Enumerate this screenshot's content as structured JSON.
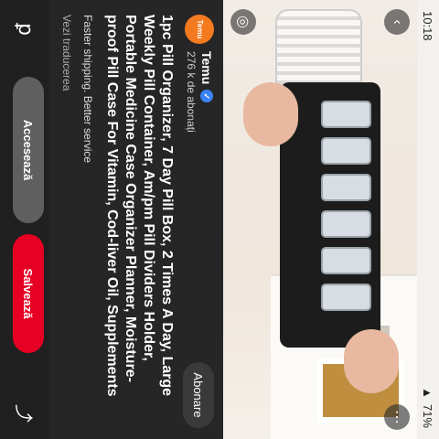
{
  "status_bar": {
    "time": "10:18",
    "battery": "71%"
  },
  "channel": {
    "avatar_text": "Temu",
    "name": "Temu",
    "subscribers": "276 k de abonați",
    "follow_label": "Abonare"
  },
  "pin": {
    "title": "1pc Pill Organizer, 7 Day Pill Box, 2 Times A Day, Large Weekly Pill Container, Am/pm Pill Dividers Holder, Portable Medicine Case Organizer Planner, Moisture-proof Pill Case For Vitamin, Cod-liver Oil, Supplements",
    "subtitle": "Faster shipping. Better service",
    "translate_label": "Vezi traducerea"
  },
  "actions": {
    "visit_label": "Accesează",
    "save_label": "Salvează"
  },
  "colors": {
    "save_button": "#e60023",
    "avatar": "#f47a20",
    "verified": "#3b82f6"
  },
  "icons": [
    "back-icon",
    "more-icon",
    "lens-icon",
    "pinterest-logo-icon",
    "share-icon",
    "verified-icon"
  ]
}
